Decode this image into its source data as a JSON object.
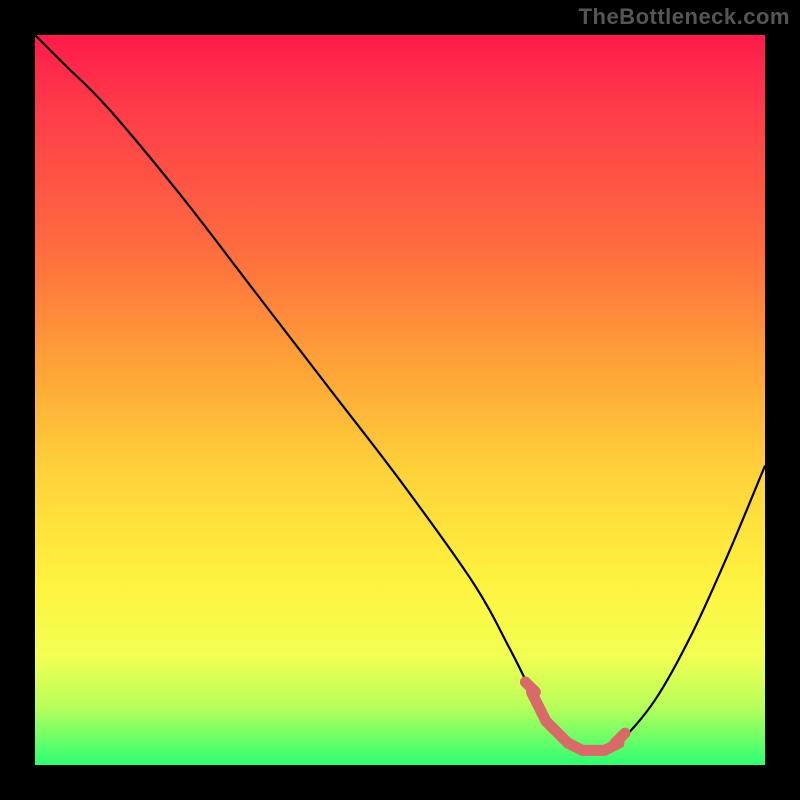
{
  "watermark": "TheBottleneck.com",
  "chart_data": {
    "type": "line",
    "title": "",
    "xlabel": "",
    "ylabel": "",
    "xlim": [
      0,
      100
    ],
    "ylim": [
      0,
      100
    ],
    "x": [
      0,
      4,
      10,
      20,
      30,
      40,
      50,
      60,
      65,
      68,
      70,
      73,
      75,
      78,
      80,
      85,
      90,
      95,
      100
    ],
    "values": [
      100,
      96,
      90,
      78,
      65,
      52,
      39,
      25,
      16,
      10,
      6,
      3,
      2,
      2,
      3,
      9,
      18,
      29,
      41
    ],
    "minimum_band_x": [
      70,
      80
    ],
    "annotations": []
  },
  "colors": {
    "curve": "#000000",
    "marker": "#d86a6a",
    "gradient_top": "#ff1a4b",
    "gradient_bottom": "#2dff73",
    "frame": "#000000"
  }
}
